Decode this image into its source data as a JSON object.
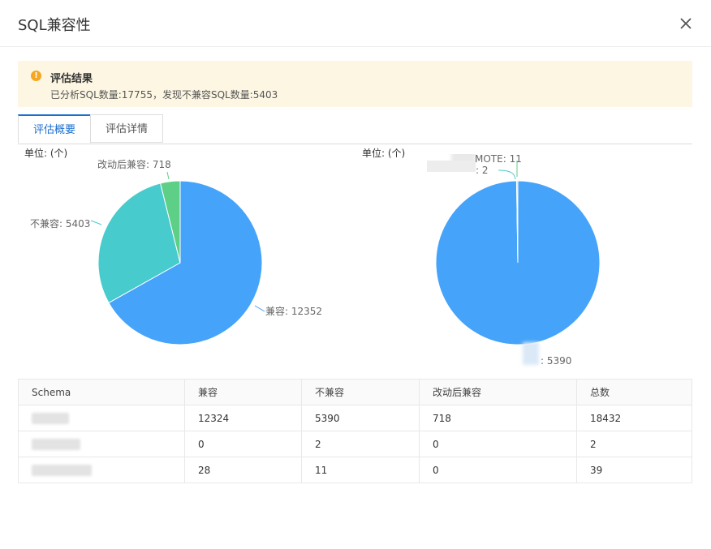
{
  "dialog": {
    "title": "SQL兼容性"
  },
  "alert": {
    "title": "评估结果",
    "description": "已分析SQL数量:17755，发现不兼容SQL数量:5403"
  },
  "tabs": [
    {
      "label": "评估概要",
      "active": true
    },
    {
      "label": "评估详情",
      "active": false
    }
  ],
  "charts": {
    "unit_label": "单位: (个)"
  },
  "chart_data": [
    {
      "type": "pie",
      "slices": [
        {
          "label": "兼容: 12352",
          "category": "兼容",
          "value": 12352,
          "color": "#45a3f9"
        },
        {
          "label": "不兼容: 5403",
          "category": "不兼容",
          "value": 5403,
          "color": "#48cbcc"
        },
        {
          "label": "改动后兼容: 718",
          "category": "改动后兼容",
          "value": 718,
          "color": "#5ecf86"
        }
      ]
    },
    {
      "type": "pie",
      "slices": [
        {
          "label": "[redacted]: 5390",
          "category": "[redacted]",
          "value": 5390,
          "color": "#45a3f9"
        },
        {
          "label": "[redacted]: 2",
          "category": "[redacted]",
          "value": 2,
          "color": "#48cbcc"
        },
        {
          "label": "[redacted]MOTE: 11",
          "category": "[redacted]MOTE",
          "value": 11,
          "color": "#5ecf86"
        }
      ],
      "visible_label_text": {
        "top": "MOTE: 11",
        "mid": ": 2",
        "bottom": ": 5390"
      }
    }
  ],
  "table": {
    "headers": [
      "Schema",
      "兼容",
      "不兼容",
      "改动后兼容",
      "总数"
    ],
    "rows": [
      [
        "[redacted]",
        "12324",
        "5390",
        "718",
        "18432"
      ],
      [
        "[redacted]",
        "0",
        "2",
        "0",
        "2"
      ],
      [
        "[redacted]",
        "28",
        "11",
        "0",
        "39"
      ]
    ]
  },
  "colors": {
    "accent": "#1b6fcf",
    "warning": "#f5a623",
    "alert_bg": "#fdf6e3"
  }
}
